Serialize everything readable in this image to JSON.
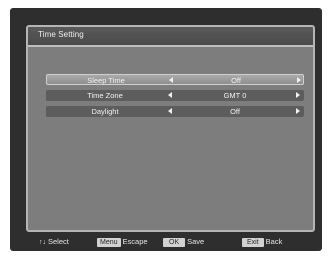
{
  "menu": {
    "title": "Time Setting",
    "rows": [
      {
        "label": "Sleep Time",
        "value": "Off",
        "selected": true
      },
      {
        "label": "Time Zone",
        "value": "GMT 0",
        "selected": false
      },
      {
        "label": "Daylight",
        "value": "Off",
        "selected": false
      }
    ]
  },
  "footer": {
    "select_icon": "↑↓",
    "select_label": "Select",
    "menu_key": "Menu",
    "menu_label": "Escape",
    "ok_key": "OK",
    "ok_label": "Save",
    "exit_key": "Exit",
    "exit_label": "Back"
  }
}
